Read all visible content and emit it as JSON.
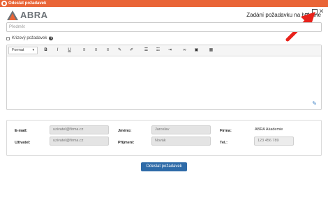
{
  "window": {
    "title": "Odeslat požadavek"
  },
  "logo": {
    "text": "ABRA"
  },
  "header": {
    "title": "Zadání požadavku na helpline"
  },
  "subject": {
    "placeholder": "Předmět"
  },
  "crisis": {
    "label": "Krizový požadavek"
  },
  "editor": {
    "format_label": "Format",
    "toolbar": [
      "bold-icon",
      "italic-icon",
      "underline-icon",
      "align-left-icon",
      "align-center-icon",
      "align-right-icon",
      "paint-icon",
      "brush-icon",
      "bullet-list-icon",
      "numbered-list-icon",
      "indent-icon",
      "link-icon",
      "image-icon",
      "table-icon"
    ],
    "bold": "B",
    "italic": "I",
    "underline": "U"
  },
  "user": {
    "email_label": "E-mail:",
    "email_value": "uzivatel@firma.cz",
    "user_label": "Uživatel:",
    "user_value": "uzivatel@firma.cz",
    "name_label": "Jméno:",
    "name_value": "Jaroslav",
    "surname_label": "Příjmení:",
    "surname_value": "Novák",
    "company_label": "Firma:",
    "company_value": "ABRA Akademie",
    "phone_label": "Tel.:",
    "phone_value": "123 456 789"
  },
  "submit": {
    "label": "Odeslat požadavek"
  },
  "colors": {
    "titlebar": "#e96537",
    "logo_orange": "#e96537",
    "submit": "#2f6ba8",
    "arrow": "#e8221b"
  }
}
